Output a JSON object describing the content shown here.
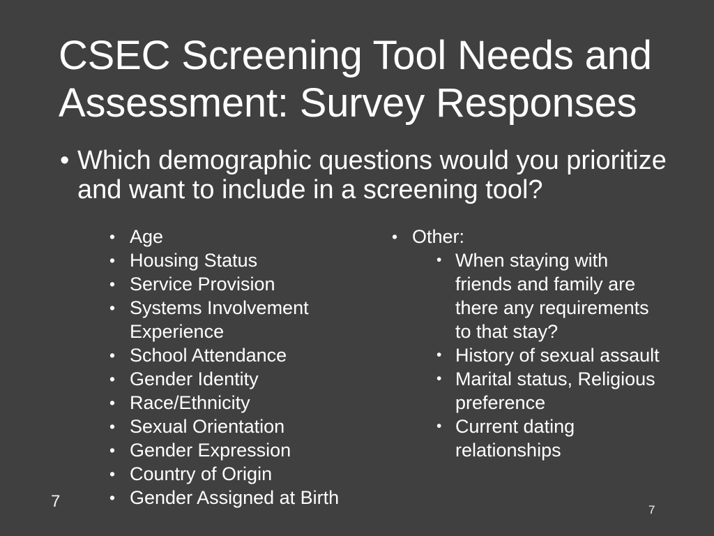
{
  "slide": {
    "background_color": "#404040",
    "text_color": "#ffffff",
    "title": "CSEC Screening Tool Needs and\nAssessment: Survey Responses",
    "bullet_glyph": "•",
    "lead_question": "Which demographic questions would you prioritize and want to include in a screening tool?",
    "left_column": {
      "items": [
        "Age",
        "Housing Status",
        "Service Provision",
        "Systems Involvement Experience",
        "School Attendance",
        "Gender Identity",
        "Race/Ethnicity",
        "Sexual Orientation",
        "Gender Expression",
        "Country of Origin",
        "Gender Assigned at Birth"
      ]
    },
    "right_column": {
      "heading": "Other:",
      "items": [
        "When staying with friends and family are there any requirements to that stay?",
        "History of sexual assault",
        "Marital status, Religious preference",
        "Current dating relationships"
      ]
    },
    "page_number_left": "7",
    "page_number_right": "7"
  }
}
